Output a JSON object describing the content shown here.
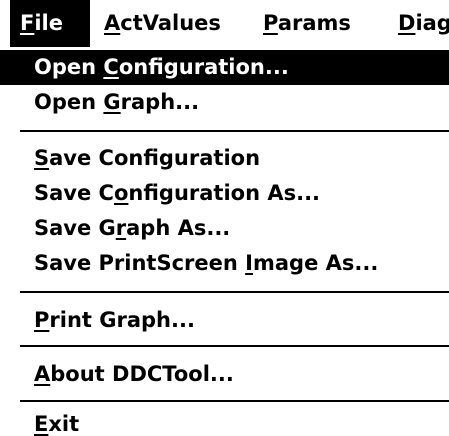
{
  "menubar": {
    "items": [
      {
        "pre": "",
        "mn": "F",
        "post": "ile",
        "active": true
      },
      {
        "pre": "",
        "mn": "A",
        "post": "ctValues",
        "active": false
      },
      {
        "pre": "",
        "mn": "P",
        "post": "arams",
        "active": false
      },
      {
        "pre": "",
        "mn": "D",
        "post": "iag",
        "active": false
      }
    ]
  },
  "file_menu": {
    "items": [
      {
        "pre": "Open ",
        "mn": "C",
        "post": "onfiguration...",
        "highlighted": true
      },
      {
        "pre": "Open ",
        "mn": "G",
        "post": "raph..."
      },
      {
        "pre": "",
        "mn": "S",
        "post": "ave Configuration"
      },
      {
        "pre": "Save C",
        "mn": "o",
        "post": "nfiguration As..."
      },
      {
        "pre": "Save G",
        "mn": "r",
        "post": "aph As..."
      },
      {
        "pre": "Save PrintScreen ",
        "mn": "I",
        "post": "mage As..."
      },
      {
        "pre": "",
        "mn": "P",
        "post": "rint Graph..."
      },
      {
        "pre": "",
        "mn": "A",
        "post": "bout DDCTool..."
      },
      {
        "pre": "",
        "mn": "E",
        "post": "xit"
      }
    ]
  },
  "colors": {
    "highlight_bg": "#000000",
    "highlight_fg": "#ffffff",
    "menu_bg": "#ffffff",
    "text": "#000000"
  }
}
